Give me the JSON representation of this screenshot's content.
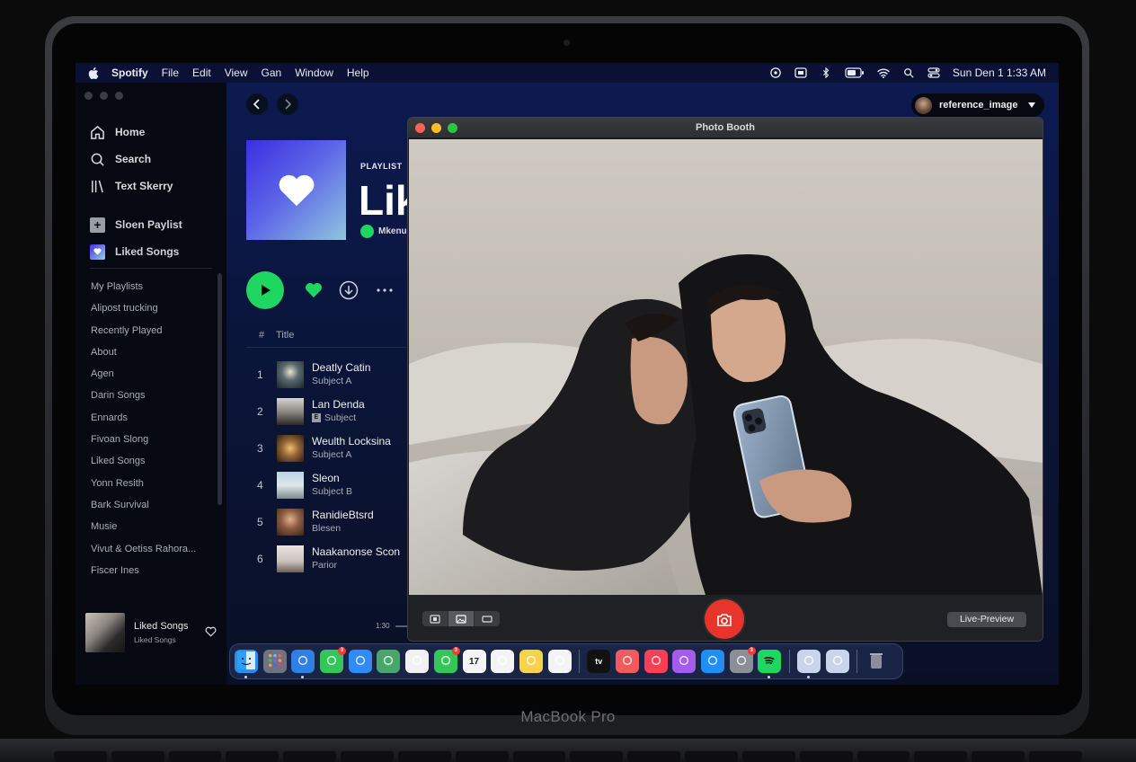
{
  "device": {
    "brand": "MacBook Pro"
  },
  "menubar": {
    "app": "Spotify",
    "items": [
      "File",
      "Edit",
      "View",
      "Gan",
      "Window",
      "Help"
    ],
    "clock": "Sun Den 1  1:33 AM",
    "status_icons": [
      "vpn-icon",
      "keyboard-icon",
      "bluetooth-icon",
      "battery-icon",
      "wifi-icon",
      "spotlight-icon",
      "control-center-icon"
    ]
  },
  "sidebar": {
    "nav": [
      {
        "label": "Home",
        "icon": "home-icon"
      },
      {
        "label": "Search",
        "icon": "search-icon"
      },
      {
        "label": "Text Skerry",
        "icon": "library-icon"
      }
    ],
    "actions": [
      {
        "label": "Sloen Paylist",
        "icon": "plus-icon"
      },
      {
        "label": "Liked Songs",
        "icon": "heart-icon"
      }
    ],
    "library": [
      "My Playlists",
      "Alipost trucking",
      "Recently Played",
      "About",
      "Agen",
      "Darin Songs",
      "Ennards",
      "Fivoan Slong",
      "Liked Songs",
      "Yonn Resith",
      "Bark Survival",
      "Musie",
      "Vivut & Oetiss Rahora...",
      "Fiscer Ines"
    ]
  },
  "now_playing": {
    "title": "Liked Songs",
    "subtitle": "Liked Songs",
    "elapsed": "1:30"
  },
  "header": {
    "user": "reference_image"
  },
  "playlist": {
    "type": "PLAYLIST",
    "title": "Liked Songs",
    "owner": "Mkenu",
    "table_header": {
      "num": "#",
      "title": "Title"
    },
    "tracks": [
      {
        "num": "1",
        "name": "Deatly Catin",
        "artist": "Subject A",
        "explicit": false
      },
      {
        "num": "2",
        "name": "Lan Denda",
        "artist": "Subject",
        "explicit": true
      },
      {
        "num": "3",
        "name": "Weulth Locksina",
        "artist": "Subject A",
        "explicit": false
      },
      {
        "num": "4",
        "name": "Sleon",
        "artist": "Subject B",
        "explicit": false
      },
      {
        "num": "5",
        "name": "RanidieBtsrd",
        "artist": "Blesen",
        "explicit": false
      },
      {
        "num": "6",
        "name": "Naakanonse Scon",
        "artist": "Parior",
        "explicit": false
      }
    ],
    "explicit_badge": "E"
  },
  "photobooth": {
    "title": "Photo Booth",
    "live_label": "Live-Preview"
  },
  "dock": {
    "apps": [
      {
        "name": "finder",
        "color": "#2a8cf0",
        "badge": ""
      },
      {
        "name": "launchpad",
        "color": "#6f7280",
        "badge": ""
      },
      {
        "name": "safari",
        "color": "#2f7fe4",
        "badge": ""
      },
      {
        "name": "messages",
        "color": "#35c65a",
        "badge": "3"
      },
      {
        "name": "mail",
        "color": "#2f8bf5",
        "badge": ""
      },
      {
        "name": "maps",
        "color": "#4aa56a",
        "badge": ""
      },
      {
        "name": "photos",
        "color": "#f2f2f2",
        "badge": ""
      },
      {
        "name": "facetime",
        "color": "#35c65a",
        "badge": "3"
      },
      {
        "name": "calendar",
        "color": "#f4f4f4",
        "badge": ""
      },
      {
        "name": "reminders",
        "color": "#f4f4f4",
        "badge": ""
      },
      {
        "name": "notes",
        "color": "#f6d34a",
        "badge": ""
      },
      {
        "name": "freeform",
        "color": "#f4f4f4",
        "badge": ""
      },
      {
        "name": "tv",
        "color": "#111111",
        "badge": ""
      },
      {
        "name": "news",
        "color": "#f25b5b",
        "badge": ""
      },
      {
        "name": "music",
        "color": "#fa3e55",
        "badge": ""
      },
      {
        "name": "podcasts",
        "color": "#a35bf0",
        "badge": ""
      },
      {
        "name": "app-store",
        "color": "#1f8ef5",
        "badge": ""
      },
      {
        "name": "system-settings",
        "color": "#8d8f96",
        "badge": "3"
      },
      {
        "name": "spotify",
        "color": "#1ed760",
        "badge": ""
      },
      {
        "name": "preview-1",
        "color": "#c9d4ea",
        "badge": ""
      },
      {
        "name": "preview-2",
        "color": "#c9d4ea",
        "badge": ""
      },
      {
        "name": "trash",
        "color": "#6d7079",
        "badge": ""
      }
    ],
    "calendar_month": "FEB",
    "calendar_day": "17",
    "tv_label": "tv"
  }
}
